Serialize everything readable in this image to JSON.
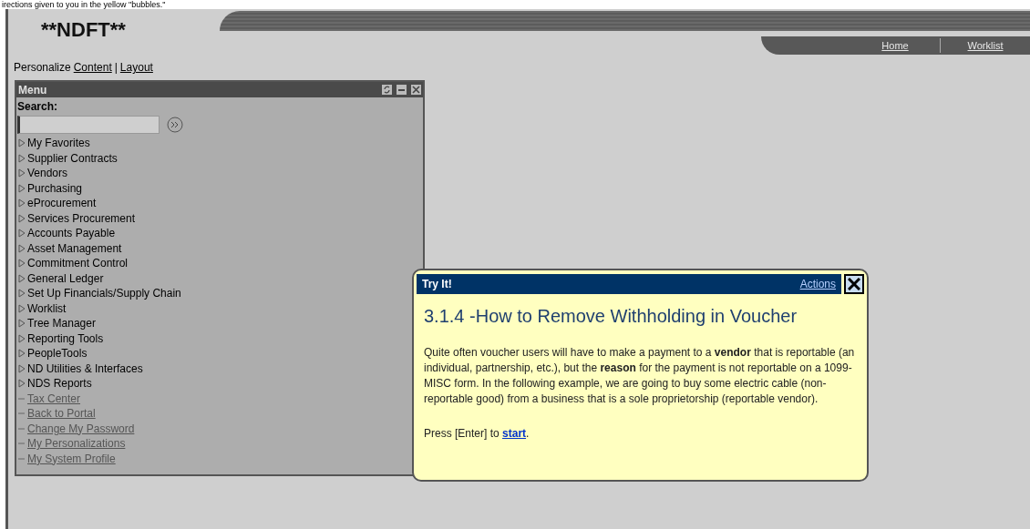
{
  "top_caption": "irections given to you in the yellow \"bubbles.\"",
  "logo": "**NDFT**",
  "nav_links": [
    {
      "label": "Home"
    },
    {
      "label": "Worklist"
    }
  ],
  "personalize": {
    "label": "Personalize",
    "links": [
      "Content",
      "Layout"
    ],
    "separator": "|"
  },
  "menu": {
    "title": "Menu",
    "search_label": "Search:",
    "items": [
      {
        "label": "My Favorites",
        "kind": "folder"
      },
      {
        "label": "Supplier Contracts",
        "kind": "folder"
      },
      {
        "label": "Vendors",
        "kind": "folder"
      },
      {
        "label": "Purchasing",
        "kind": "folder"
      },
      {
        "label": "eProcurement",
        "kind": "folder"
      },
      {
        "label": "Services Procurement",
        "kind": "folder"
      },
      {
        "label": "Accounts Payable",
        "kind": "folder"
      },
      {
        "label": "Asset Management",
        "kind": "folder"
      },
      {
        "label": "Commitment Control",
        "kind": "folder"
      },
      {
        "label": "General Ledger",
        "kind": "folder"
      },
      {
        "label": "Set Up Financials/Supply Chain",
        "kind": "folder"
      },
      {
        "label": "Worklist",
        "kind": "folder"
      },
      {
        "label": "Tree Manager",
        "kind": "folder"
      },
      {
        "label": "Reporting Tools",
        "kind": "folder"
      },
      {
        "label": "PeopleTools",
        "kind": "folder"
      },
      {
        "label": "ND Utilities & Interfaces",
        "kind": "folder"
      },
      {
        "label": "NDS Reports",
        "kind": "folder"
      },
      {
        "label": "Tax Center",
        "kind": "link"
      },
      {
        "label": "Back to Portal",
        "kind": "link"
      },
      {
        "label": "Change My Password",
        "kind": "link"
      },
      {
        "label": "My Personalizations",
        "kind": "link"
      },
      {
        "label": "My System Profile",
        "kind": "link"
      }
    ]
  },
  "bubble": {
    "header": "Try It!",
    "actions": "Actions",
    "title": "3.1.4 -How to Remove Withholding in Voucher",
    "body": "Quite often voucher users will have to make a payment to a **vendor** that is reportable (an individual, partnership, etc.), but the **reason** for the payment is not reportable on a 1099-MISC form.  In the following example, we are going to buy some electric cable (non-reportable good) from a business that is a sole proprietorship (reportable vendor).",
    "prompt": "Press [Enter] to",
    "prompt_link": "start",
    "prompt_end": "."
  }
}
